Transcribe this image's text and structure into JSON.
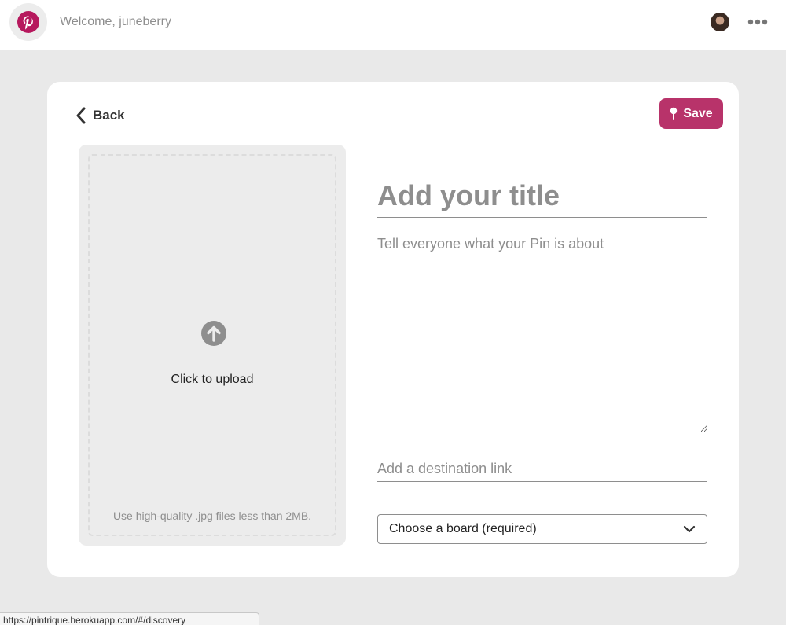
{
  "header": {
    "welcome_text": "Welcome, juneberry",
    "logo_icon": "pinterest-logo-icon",
    "avatar_icon": "user-avatar",
    "more_icon": "more-horizontal-icon",
    "brand_color": "#b6185d"
  },
  "toolbar": {
    "back_label": "Back",
    "back_icon": "chevron-left-icon",
    "save_label": "Save",
    "save_icon": "pin-icon",
    "save_color": "#b8336a"
  },
  "upload": {
    "icon": "arrow-up-circle-icon",
    "label": "Click to upload",
    "hint": "Use high-quality .jpg files less than 2MB."
  },
  "form": {
    "title_placeholder": "Add your title",
    "title_value": "",
    "description_placeholder": "Tell everyone what your Pin is about",
    "description_value": "",
    "link_placeholder": "Add a destination link",
    "link_value": "",
    "board_select_label": "Choose a board (required)",
    "board_select_icon": "chevron-down-icon"
  },
  "status_bar": {
    "url": "https://pintrique.herokuapp.com/#/discovery"
  }
}
